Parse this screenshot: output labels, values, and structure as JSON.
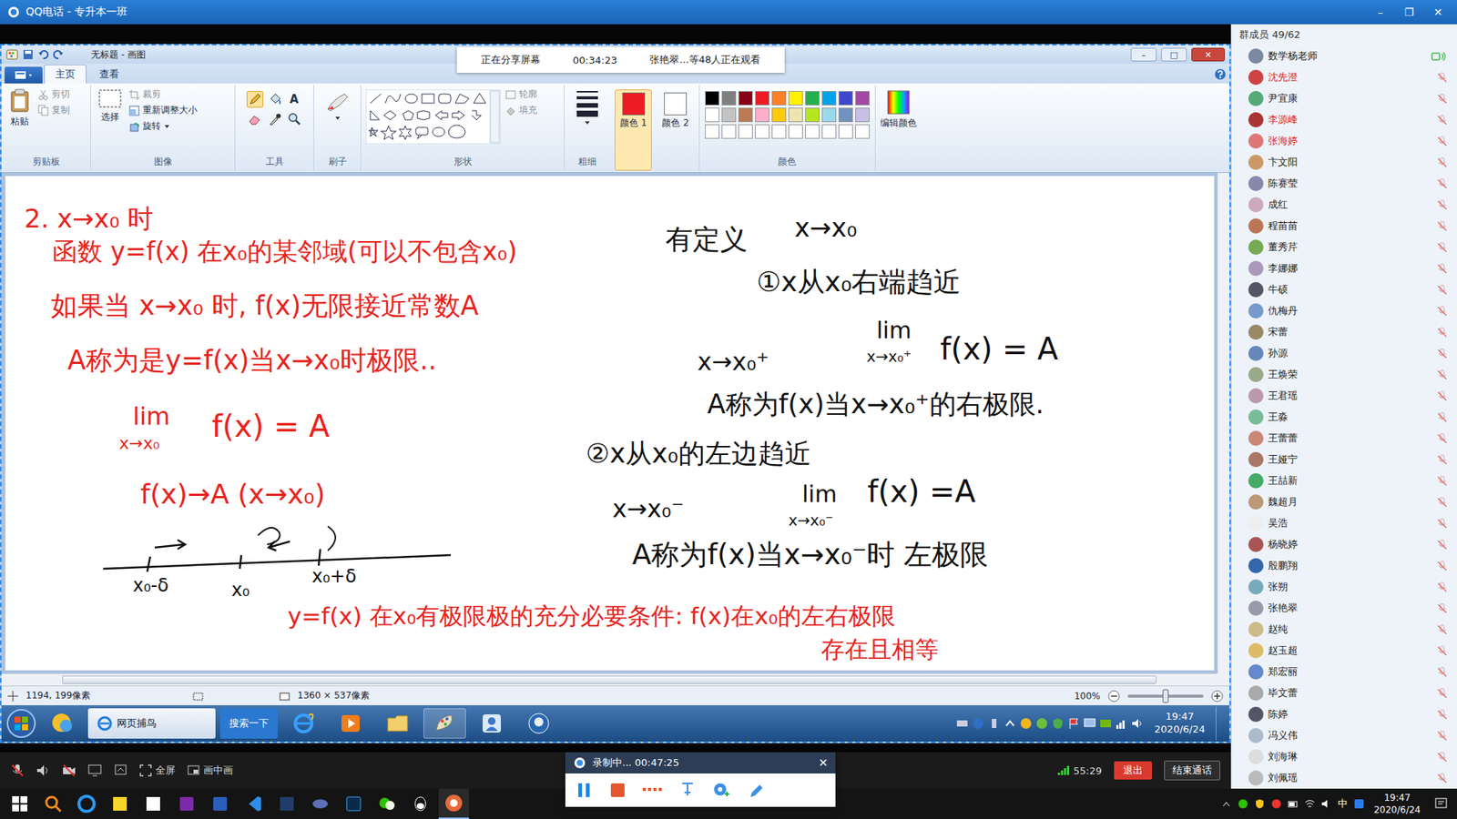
{
  "qq_window": {
    "title": "QQ电话 - 专升本一班",
    "controls": [
      "–",
      "❐",
      "✕"
    ]
  },
  "share_banner": {
    "status": "正在分享屏幕",
    "elapsed": "00:34:23",
    "viewers": "张艳翠...等48人正在观看"
  },
  "paint": {
    "title": "无标题 - 画图",
    "title_controls": [
      "–",
      "□",
      "✕"
    ],
    "tabs": [
      {
        "label": "主页",
        "selected": true
      },
      {
        "label": "查看",
        "selected": false
      }
    ],
    "clipboard": {
      "label": "剪贴板",
      "paste": "粘贴",
      "cut": "剪切",
      "copy": "复制"
    },
    "image": {
      "label": "图像",
      "select": "选择",
      "crop": "裁剪",
      "resize": "重新调整大小",
      "rotate": "旋转"
    },
    "tools": {
      "label": "工具",
      "text_tool": "A"
    },
    "brush": {
      "label": "刷子"
    },
    "shapes": {
      "label": "形状",
      "outline": "轮廓",
      "fill": "填充"
    },
    "size": {
      "label": "粗细"
    },
    "color1": {
      "label": "颜色 1",
      "color": "#ed1c24",
      "selected": true
    },
    "color2": {
      "label": "颜色 2",
      "color": "#ffffff",
      "selected": false
    },
    "palette": {
      "label": "颜色",
      "swatches": [
        "#000000",
        "#7f7f7f",
        "#880015",
        "#ed1c24",
        "#ff7f27",
        "#fff200",
        "#22b14c",
        "#00a2e8",
        "#3f48cc",
        "#a349a4",
        "#ffffff",
        "#c3c3c3",
        "#b97a57",
        "#ffaec9",
        "#ffc90e",
        "#efe4b0",
        "#b5e61d",
        "#99d9ea",
        "#7092be",
        "#c8bfe7",
        "#ffffff",
        "#ffffff",
        "#ffffff",
        "#ffffff",
        "#ffffff",
        "#ffffff",
        "#ffffff",
        "#ffffff",
        "#ffffff",
        "#ffffff"
      ]
    },
    "edit_colors": "编辑颜色",
    "notes": [
      {
        "text": "2. x→x₀ 时",
        "color": "#e8231d"
      },
      {
        "text": "函数 y=f(x) 在x₀的某邻域(可以不包含x₀)",
        "color": "#e8231d"
      },
      {
        "text": "有定义",
        "color": "#111111"
      },
      {
        "text": "如果当 x→x₀ 时, f(x)无限接近常数A",
        "color": "#e8231d"
      },
      {
        "text": "A称为是y=f(x)当x→x₀时极限..",
        "color": "#e8231d"
      },
      {
        "text": "lim",
        "color": "#e8231d"
      },
      {
        "text": "x→x₀",
        "color": "#e8231d"
      },
      {
        "text": "f(x) = A",
        "color": "#e8231d"
      },
      {
        "text": "f(x)→A (x→x₀)",
        "color": "#e8231d"
      },
      {
        "text": "x₀-δ",
        "color": "#111111"
      },
      {
        "text": "x₀",
        "color": "#111111"
      },
      {
        "text": "x₀+δ",
        "color": "#111111"
      },
      {
        "text": "y=f(x) 在x₀有极限极的充分必要条件: f(x)在x₀的左右极限",
        "color": "#e8231d"
      },
      {
        "text": "存在且相等",
        "color": "#e8231d"
      },
      {
        "text": "x→x₀",
        "color": "#111111"
      },
      {
        "text": "①x从x₀右端趋近",
        "color": "#111111"
      },
      {
        "text": "x→x₀⁺",
        "color": "#111111"
      },
      {
        "text": "lim",
        "color": "#111111"
      },
      {
        "text": "x→x₀⁺",
        "color": "#111111"
      },
      {
        "text": "f(x) = A",
        "color": "#111111"
      },
      {
        "text": "A称为f(x)当x→x₀⁺的右极限.",
        "color": "#111111"
      },
      {
        "text": "②x从x₀的左边趋近",
        "color": "#111111"
      },
      {
        "text": "x→x₀⁻",
        "color": "#111111"
      },
      {
        "text": "lim",
        "color": "#111111"
      },
      {
        "text": "x→x₀⁻",
        "color": "#111111"
      },
      {
        "text": "f(x) =A",
        "color": "#111111"
      },
      {
        "text": "A称为f(x)当x→x₀⁻时 左极限",
        "color": "#111111"
      }
    ],
    "status_bar": {
      "cursor": "1194, 199像素",
      "canvas_size": "1360 × 537像素",
      "zoom": "100%",
      "zoom_level": 0.5
    }
  },
  "win7_taskbar": {
    "browser_button": "网页捕鸟",
    "search_button": "搜索一下",
    "time": "19:47",
    "date": "2020/6/24"
  },
  "call_bar": {
    "fullscreen": "全屏",
    "pip": "画中画",
    "signal": "55:29",
    "exit": "退出",
    "end": "结束通话"
  },
  "recorder": {
    "status": "录制中... 00:47:25",
    "close": "✕"
  },
  "members": {
    "header": "群成员 49/62",
    "items": [
      {
        "name": "数学杨老师",
        "color": "#222222",
        "muted": false
      },
      {
        "name": "沈先澄",
        "color": "#e02020",
        "muted": true
      },
      {
        "name": "尹宜康",
        "color": "#222222",
        "muted": true
      },
      {
        "name": "李源峰",
        "color": "#e02020",
        "muted": true
      },
      {
        "name": "张海婷",
        "color": "#e02020",
        "muted": true
      },
      {
        "name": "卞文阳",
        "color": "#222222",
        "muted": true
      },
      {
        "name": "陈赛莹",
        "color": "#222222",
        "muted": true
      },
      {
        "name": "成红",
        "color": "#222222",
        "muted": true
      },
      {
        "name": "程苗苗",
        "color": "#222222",
        "muted": true
      },
      {
        "name": "董秀芹",
        "color": "#222222",
        "muted": true
      },
      {
        "name": "李娜娜",
        "color": "#222222",
        "muted": true
      },
      {
        "name": "牛硕",
        "color": "#222222",
        "muted": true
      },
      {
        "name": "仇梅丹",
        "color": "#222222",
        "muted": true
      },
      {
        "name": "宋蕾",
        "color": "#222222",
        "muted": true
      },
      {
        "name": "孙源",
        "color": "#222222",
        "muted": true
      },
      {
        "name": "王焕荣",
        "color": "#222222",
        "muted": true
      },
      {
        "name": "王君瑶",
        "color": "#222222",
        "muted": true
      },
      {
        "name": "王淼",
        "color": "#222222",
        "muted": true
      },
      {
        "name": "王蕾蕾",
        "color": "#222222",
        "muted": true
      },
      {
        "name": "王娅宁",
        "color": "#222222",
        "muted": true
      },
      {
        "name": "王喆新",
        "color": "#222222",
        "muted": true
      },
      {
        "name": "魏超月",
        "color": "#222222",
        "muted": true
      },
      {
        "name": "吴浩",
        "color": "#222222",
        "muted": true
      },
      {
        "name": "杨晓婷",
        "color": "#222222",
        "muted": true
      },
      {
        "name": "殷鹏翔",
        "color": "#222222",
        "muted": true
      },
      {
        "name": "张朔",
        "color": "#222222",
        "muted": true
      },
      {
        "name": "张艳翠",
        "color": "#222222",
        "muted": true
      },
      {
        "name": "赵纯",
        "color": "#222222",
        "muted": true
      },
      {
        "name": "赵玉超",
        "color": "#222222",
        "muted": true
      },
      {
        "name": "郑宏丽",
        "color": "#222222",
        "muted": true
      },
      {
        "name": "毕文蕾",
        "color": "#222222",
        "muted": true
      },
      {
        "name": "陈婷",
        "color": "#222222",
        "muted": true
      },
      {
        "name": "冯义伟",
        "color": "#222222",
        "muted": true
      },
      {
        "name": "刘海琳",
        "color": "#222222",
        "muted": true
      },
      {
        "name": "刘佩瑶",
        "color": "#222222",
        "muted": true
      }
    ]
  },
  "win10_taskbar": {
    "ime": "中",
    "time": "19:47",
    "date": "2020/6/24"
  }
}
